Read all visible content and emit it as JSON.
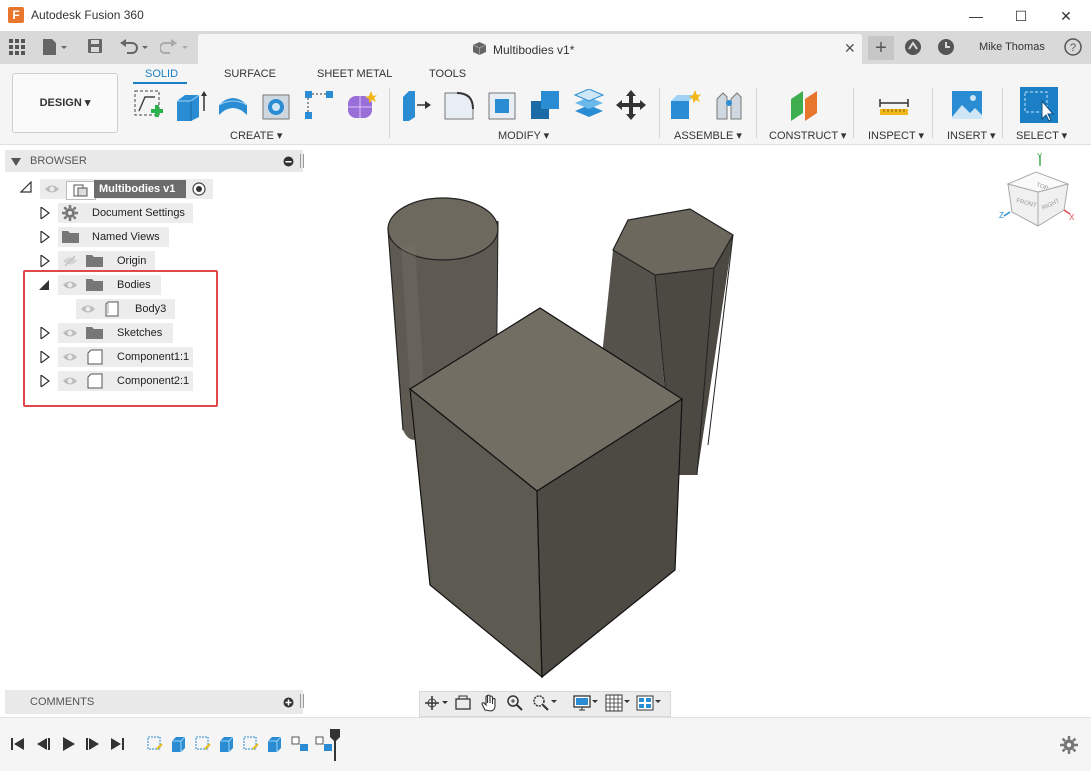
{
  "app": {
    "title": "Autodesk Fusion 360",
    "logo_letter": "F"
  },
  "window_controls": {
    "minimize": "—",
    "maximize": "☐",
    "close": "✕"
  },
  "document": {
    "tab_title": "Multibodies v1*",
    "close": "✕"
  },
  "user": {
    "name": "Mike Thomas"
  },
  "toolbar": {
    "workspace_button": "DESIGN ▾",
    "tabs": [
      "SOLID",
      "SURFACE",
      "SHEET METAL",
      "TOOLS"
    ],
    "groups": [
      "CREATE ▾",
      "MODIFY ▾",
      "ASSEMBLE ▾",
      "CONSTRUCT ▾",
      "INSPECT ▾",
      "INSERT ▾",
      "SELECT ▾"
    ]
  },
  "browser": {
    "title": "BROWSER",
    "root": "Multibodies v1",
    "items": [
      "Document Settings",
      "Named Views",
      "Origin",
      "Bodies",
      "Body3",
      "Sketches",
      "Component1:1",
      "Component2:1"
    ]
  },
  "comments": {
    "title": "COMMENTS"
  },
  "viewcube": {
    "top": "TOP",
    "front": "FRONT",
    "right": "RIGHT",
    "axis_x": "X",
    "axis_y": "Y",
    "axis_z": "Z"
  },
  "colors": {
    "accent": "#1a7fc5",
    "highlight": "#e0474c",
    "body": "#6f6a60"
  }
}
